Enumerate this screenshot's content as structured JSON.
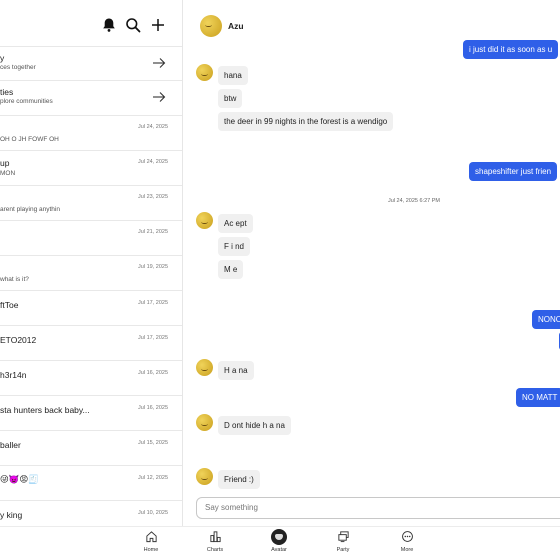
{
  "left_panel": {
    "icons": [
      "bell-icon",
      "search-icon",
      "plus-icon"
    ],
    "promos": [
      {
        "title": "y",
        "subtitle": "ces together"
      },
      {
        "title": "ties",
        "subtitle": "plore communities"
      }
    ],
    "conversations": [
      {
        "title": "",
        "preview": "OH O JH FOWF OH",
        "date": "Jul 24, 2025"
      },
      {
        "title": "up",
        "preview": "MON",
        "date": "Jul 24, 2025"
      },
      {
        "title": "",
        "preview": "arent playing anythin",
        "date": "Jul 23, 2025"
      },
      {
        "title": "",
        "preview": "",
        "date": "Jul 21, 2025"
      },
      {
        "title": "",
        "preview": "what is it?",
        "date": "Jul 19, 2025"
      },
      {
        "title": "ftToe",
        "preview": "",
        "date": "Jul 17, 2025"
      },
      {
        "title": "ETO2012",
        "preview": "",
        "date": "Jul 17, 2025"
      },
      {
        "title": "h3r14n",
        "preview": "",
        "date": "Jul 16, 2025"
      },
      {
        "title": "sta hunters back baby...",
        "preview": "",
        "date": "Jul 16, 2025"
      },
      {
        "title": "baller",
        "preview": "",
        "date": "Jul 15, 2025"
      },
      {
        "title": "😜👿😡🧾",
        "preview": "",
        "date": "Jul 12, 2025"
      },
      {
        "title": "y king",
        "preview": "",
        "date": "Jul 10, 2025"
      }
    ]
  },
  "chat": {
    "contact_name": "Azu",
    "messages": [
      {
        "side": "out",
        "text": "i just did it as soon as u"
      },
      {
        "side": "in",
        "text": "hana"
      },
      {
        "side": "in",
        "text": "btw"
      },
      {
        "side": "in",
        "text": "the deer in 99 nights in the forest is a wendigo"
      },
      {
        "side": "out",
        "text": "shapeshifter just frien"
      },
      {
        "side": "separator",
        "text": "Jul 24, 2025 6:27 PM"
      },
      {
        "side": "in",
        "text": "Ac ept"
      },
      {
        "side": "in",
        "text": "F i nd"
      },
      {
        "side": "in",
        "text": "M e"
      },
      {
        "side": "out",
        "text": "NONO"
      },
      {
        "side": "in",
        "text": "H a na"
      },
      {
        "side": "out",
        "text": "NO MATT"
      },
      {
        "side": "in",
        "text": "D ont hide h a na"
      },
      {
        "side": "in",
        "text": "Friend :)"
      }
    ],
    "composer_placeholder": "Say something"
  },
  "bottom_nav": [
    {
      "label": "Home",
      "icon": "home-icon"
    },
    {
      "label": "Charts",
      "icon": "charts-icon"
    },
    {
      "label": "Avatar",
      "icon": "avatar-icon"
    },
    {
      "label": "Party",
      "icon": "party-icon"
    },
    {
      "label": "More",
      "icon": "more-icon"
    }
  ],
  "colors": {
    "outgoing_bubble": "#2f5fe8",
    "incoming_bubble": "#f0f0f0",
    "divider": "#e8e8e8"
  }
}
